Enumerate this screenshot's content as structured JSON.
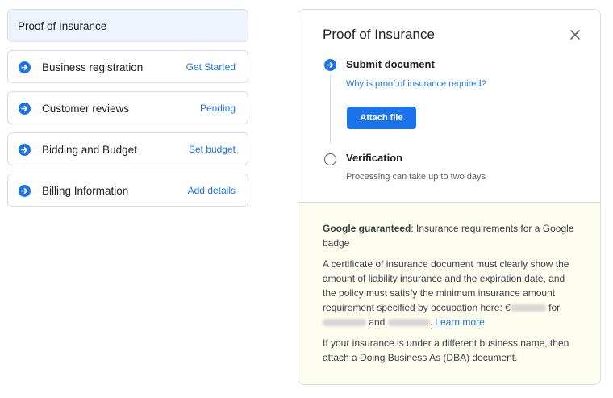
{
  "checklist": {
    "selected_title": "Proof of Insurance",
    "items": [
      {
        "label": "Business registration",
        "action": "Get Started"
      },
      {
        "label": "Customer reviews",
        "action": "Pending"
      },
      {
        "label": "Bidding and Budget",
        "action": "Set budget"
      },
      {
        "label": "Billing Information",
        "action": "Add details"
      }
    ]
  },
  "panel": {
    "title": "Proof of Insurance",
    "close_icon": "close-icon",
    "step1": {
      "title": "Submit document",
      "link": "Why is proof of insurance required?",
      "button": "Attach file"
    },
    "step2": {
      "title": "Verification",
      "subtitle": "Processing can take up to two days"
    },
    "info": {
      "guarantee_bold": "Google guaranteed",
      "guarantee_rest": ": Insurance requirements for a Google badge",
      "body_text": "A certificate of insurance document must clearly show the amount of liability insurance and the expiration date, and the policy must satisfy the minimum insurance amount requirement specified by occupation here: €",
      "for_text": " for",
      "and_text": " and ",
      "period": ". ",
      "learn_more": "Learn more",
      "dba_text": "If your insurance is under a different business name, then attach a Doing Business As (DBA) document."
    }
  },
  "colors": {
    "accent": "#1a73e8",
    "selected_bg": "#eef3fd",
    "info_bg": "#fefef0",
    "border": "#dadce0"
  }
}
